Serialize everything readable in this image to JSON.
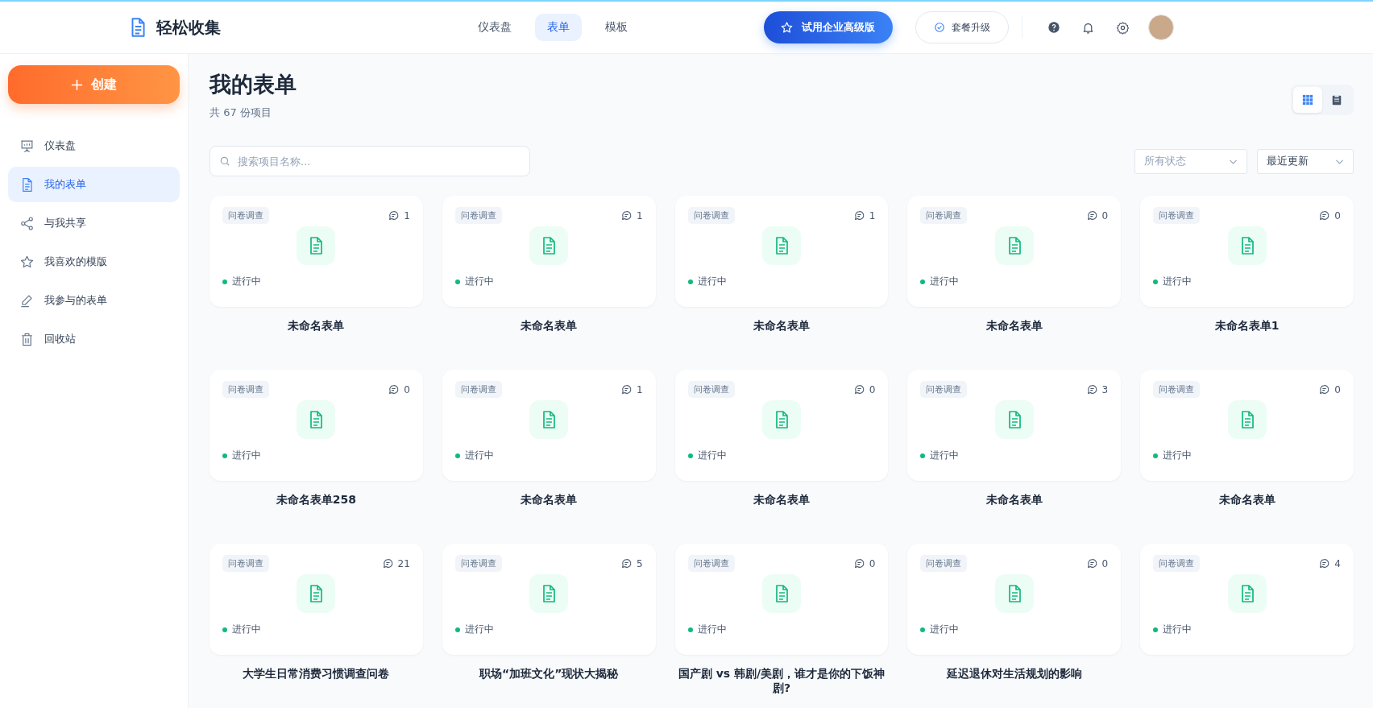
{
  "header": {
    "brand": "轻松收集",
    "nav": [
      {
        "label": "仪表盘",
        "selected": false
      },
      {
        "label": "表单",
        "selected": true
      },
      {
        "label": "模板",
        "selected": false
      }
    ],
    "trial_button": "试用企业高级版",
    "upgrade_button": "套餐升级"
  },
  "sidebar": {
    "create_button": "创建",
    "items": [
      {
        "label": "仪表盘",
        "selected": false
      },
      {
        "label": "我的表单",
        "selected": true
      },
      {
        "label": "与我共享",
        "selected": false
      },
      {
        "label": "我喜欢的模版",
        "selected": false
      },
      {
        "label": "我参与的表单",
        "selected": false
      },
      {
        "label": "回收站",
        "selected": false
      }
    ]
  },
  "page": {
    "title": "我的表单",
    "subtitle": "共 67 份项目",
    "view_toggle": [
      {
        "kind": "grid",
        "selected": true
      },
      {
        "kind": "list",
        "selected": false
      }
    ],
    "search": {
      "placeholder": "搜索项目名称..."
    },
    "filters": [
      {
        "placeholder": "所有状态"
      },
      {
        "value": "最近更新"
      }
    ]
  },
  "forms": [
    {
      "tag": "问卷调查",
      "comments": "1",
      "status": "进行中",
      "title": "未命名表单"
    },
    {
      "tag": "问卷调查",
      "comments": "1",
      "status": "进行中",
      "title": "未命名表单"
    },
    {
      "tag": "问卷调查",
      "comments": "1",
      "status": "进行中",
      "title": "未命名表单"
    },
    {
      "tag": "问卷调查",
      "comments": "0",
      "status": "进行中",
      "title": "未命名表单"
    },
    {
      "tag": "问卷调查",
      "comments": "0",
      "status": "进行中",
      "title": "未命名表单1"
    },
    {
      "tag": "问卷调查",
      "comments": "0",
      "status": "进行中",
      "title": "未命名表单258"
    },
    {
      "tag": "问卷调查",
      "comments": "1",
      "status": "进行中",
      "title": "未命名表单"
    },
    {
      "tag": "问卷调查",
      "comments": "0",
      "status": "进行中",
      "title": "未命名表单"
    },
    {
      "tag": "问卷调查",
      "comments": "3",
      "status": "进行中",
      "title": "未命名表单"
    },
    {
      "tag": "问卷调查",
      "comments": "0",
      "status": "进行中",
      "title": "未命名表单"
    },
    {
      "tag": "问卷调查",
      "comments": "21",
      "status": "进行中",
      "title": "大学生日常消费习惯调查问卷"
    },
    {
      "tag": "问卷调查",
      "comments": "5",
      "status": "进行中",
      "title": "职场“加班文化”现状大揭秘"
    },
    {
      "tag": "问卷调查",
      "comments": "0",
      "status": "进行中",
      "title": "国产剧 vs 韩剧/美剧，谁才是你的下饭神剧?"
    },
    {
      "tag": "问卷调查",
      "comments": "0",
      "status": "进行中",
      "title": "延迟退休对生活规划的影响"
    },
    {
      "tag": "问卷调查",
      "comments": "4",
      "status": "进行中"
    }
  ]
}
